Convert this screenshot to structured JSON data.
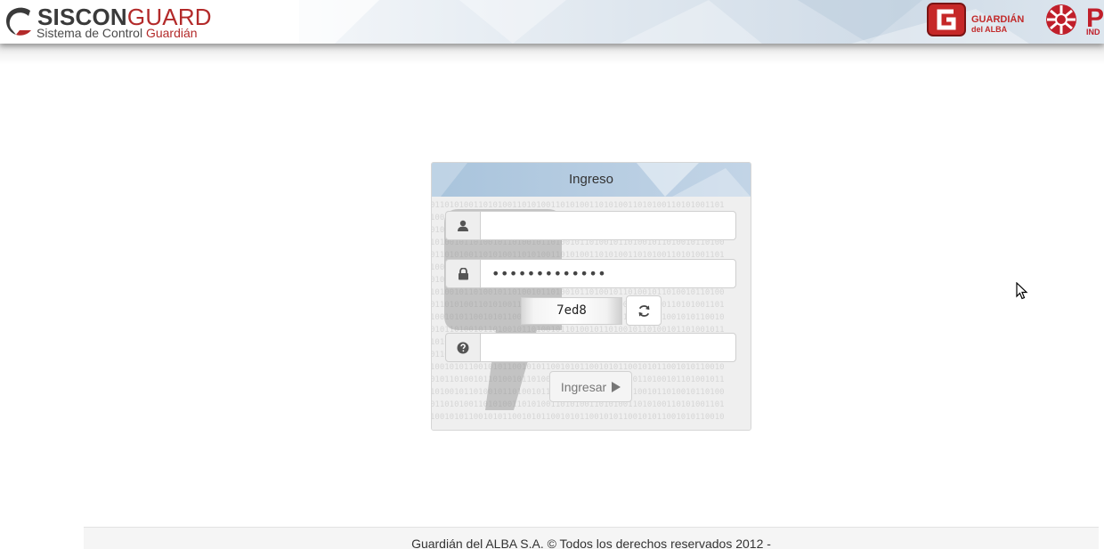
{
  "header": {
    "logo_title_part1": "SISCON",
    "logo_title_part2": "GUARD",
    "logo_sub_part1": "Sistema de Control ",
    "logo_sub_part2": "Guardián",
    "brand1_line1": "GUARDIÁN",
    "brand1_line2": "del ALBA",
    "brand2_letter": "P",
    "brand2_sub": "IND",
    "colors": {
      "brand_red": "#b32a2a",
      "dark_text": "#3a3a3a"
    }
  },
  "login": {
    "title": "Ingreso",
    "username": {
      "value": "",
      "placeholder": "",
      "icon": "user-icon"
    },
    "password": {
      "value": "•••••••••••••",
      "placeholder": "",
      "icon": "lock-icon"
    },
    "captcha": {
      "text": "7ed8",
      "refresh_icon": "refresh-icon"
    },
    "captcha_answer": {
      "value": "",
      "placeholder": "",
      "icon": "question-circle-icon"
    },
    "submit_label": "Ingresar",
    "submit_icon": "play-icon",
    "colors": {
      "heading_bg": "#b7cde2",
      "panel_bg": "#f1f1f1"
    }
  },
  "footer": {
    "text": "Guardián del ALBA S.A. © Todos los derechos reservados 2012 -"
  }
}
